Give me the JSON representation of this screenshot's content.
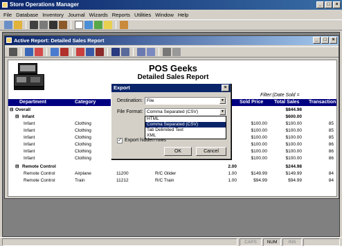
{
  "app": {
    "title": "Store Operations Manager"
  },
  "menu": [
    "File",
    "Database",
    "Inventory",
    "Journal",
    "Wizards",
    "Reports",
    "Utilities",
    "Window",
    "Help"
  ],
  "child_window": {
    "title": "Active Report: Detailed Sales Report"
  },
  "report": {
    "company": "POS Geeks",
    "title": "Detailed Sales Report",
    "filter_label": "Filter:(Date Sold  =",
    "columns": [
      "Department",
      "Category",
      "Sold Price",
      "Total Sales",
      "Transaction"
    ],
    "overall": {
      "label": "Overall",
      "total": "$844.98"
    },
    "groups": [
      {
        "label": "Infant",
        "total": "$600.00",
        "rows": [
          {
            "dept": "Infant",
            "cat": "Clothing",
            "price": "$100.00",
            "total": "$100.00",
            "txn": "85"
          },
          {
            "dept": "Infant",
            "cat": "Clothing",
            "price": "$100.00",
            "total": "$100.00",
            "txn": "85"
          },
          {
            "dept": "Infant",
            "cat": "Clothing",
            "price": "$100.00",
            "total": "$100.00",
            "txn": "85"
          },
          {
            "dept": "Infant",
            "cat": "Clothing",
            "price": "$100.00",
            "total": "$100.00",
            "txn": "86"
          },
          {
            "dept": "Infant",
            "cat": "Clothing",
            "price": "$100.00",
            "total": "$100.00",
            "txn": "86"
          },
          {
            "dept": "Infant",
            "cat": "Clothing",
            "price": "$100.00",
            "total": "$100.00",
            "txn": "86"
          }
        ]
      },
      {
        "label": "Remote Control",
        "qty": "2.00",
        "total": "$244.98",
        "rows": [
          {
            "dept": "Remote Control",
            "cat": "Airplane",
            "item": "11200",
            "desc": "R/C Glider",
            "qty": "1.00",
            "price": "$149.99",
            "total": "$149.99",
            "txn": "84"
          },
          {
            "dept": "Remote Control",
            "cat": "Train",
            "item": "11212",
            "desc": "R/C Train",
            "qty": "1.00",
            "price": "$94.99",
            "total": "$94.99",
            "txn": "84"
          }
        ]
      }
    ]
  },
  "dialog": {
    "title": "Export",
    "destination_label": "Destination:",
    "destination_value": "File",
    "format_label": "File Format:",
    "format_value": "Comma Separated (CSV)",
    "format_options": [
      "HTML",
      "Comma Separated (CSV)",
      "Tab Delimited Text",
      "XML"
    ],
    "export_hidden_label": "Export hidden rows",
    "ok_label": "OK",
    "cancel_label": "Cancel"
  },
  "status": {
    "caps": "CAPS",
    "num": "NUM",
    "ins": "INS"
  },
  "colors": {
    "title_blue": "#0a246a",
    "header_navy": "#000080",
    "highlight": "#0a246a"
  }
}
